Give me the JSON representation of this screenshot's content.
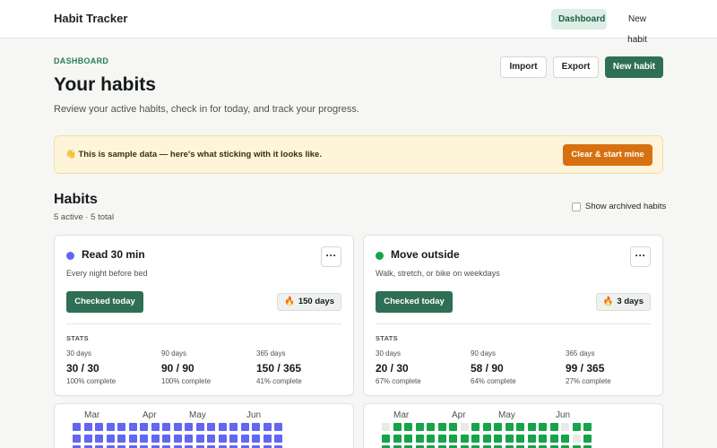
{
  "header": {
    "brand": "Habit Tracker",
    "nav": {
      "dashboard": "Dashboard",
      "new_habit": "New habit"
    }
  },
  "page": {
    "eyebrow": "DASHBOARD",
    "title": "Your habits",
    "description": "Review your active habits, check in for today, and track your progress.",
    "actions": {
      "import": "Import",
      "export": "Export",
      "new_habit": "New habit"
    }
  },
  "banner": {
    "text": "👋 This is sample data — here's what sticking with it looks like.",
    "button": "Clear & start mine"
  },
  "habits_section": {
    "title": "Habits",
    "summary": "5 active · 5 total",
    "show_archived_label": "Show archived habits",
    "show_archived_checked": false
  },
  "habits": [
    {
      "name": "Read 30 min",
      "description": "Every night before bed",
      "color": "#6366f1",
      "more": "···",
      "checked_label": "Checked today",
      "streak_icon": "fire-icon",
      "streak": "150 days",
      "stats_label": "STATS",
      "stats": [
        {
          "label": "30 days",
          "value": "30 / 30",
          "pct": "100% complete"
        },
        {
          "label": "90 days",
          "value": "90 / 90",
          "pct": "100% complete"
        },
        {
          "label": "365 days",
          "value": "150 / 365",
          "pct": "41% complete"
        }
      ],
      "calendar_months": [
        "Mar",
        "Apr",
        "May",
        "Jun"
      ],
      "calendar_color": "#6366f1",
      "calendar_empty_color": "#eceeee",
      "calendar_leading_empty": 0
    },
    {
      "name": "Move outside",
      "description": "Walk, stretch, or bike on weekdays",
      "color": "#16a34a",
      "more": "···",
      "checked_label": "Checked today",
      "streak_icon": "fire-icon",
      "streak": "3 days",
      "stats_label": "STATS",
      "stats": [
        {
          "label": "30 days",
          "value": "20 / 30",
          "pct": "67% complete"
        },
        {
          "label": "90 days",
          "value": "58 / 90",
          "pct": "64% complete"
        },
        {
          "label": "365 days",
          "value": "99 / 365",
          "pct": "27% complete"
        }
      ],
      "calendar_months": [
        "Mar",
        "Apr",
        "May",
        "Jun"
      ],
      "calendar_color": "#16a34a",
      "calendar_empty_color": "#e7ebe8",
      "calendar_leading_empty": 1
    }
  ]
}
